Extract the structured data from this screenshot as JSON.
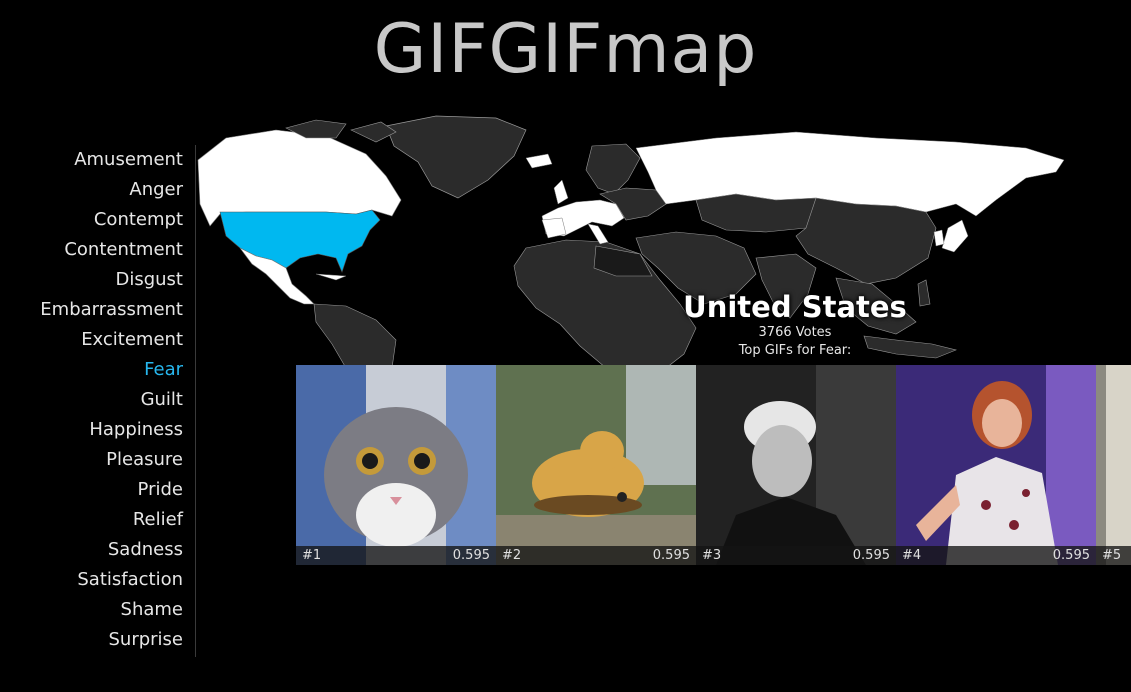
{
  "app": {
    "title": "GIFGIFmap"
  },
  "emotions": [
    {
      "label": "Amusement",
      "active": false
    },
    {
      "label": "Anger",
      "active": false
    },
    {
      "label": "Contempt",
      "active": false
    },
    {
      "label": "Contentment",
      "active": false
    },
    {
      "label": "Disgust",
      "active": false
    },
    {
      "label": "Embarrassment",
      "active": false
    },
    {
      "label": "Excitement",
      "active": false
    },
    {
      "label": "Fear",
      "active": true
    },
    {
      "label": "Guilt",
      "active": false
    },
    {
      "label": "Happiness",
      "active": false
    },
    {
      "label": "Pleasure",
      "active": false
    },
    {
      "label": "Pride",
      "active": false
    },
    {
      "label": "Relief",
      "active": false
    },
    {
      "label": "Sadness",
      "active": false
    },
    {
      "label": "Satisfaction",
      "active": false
    },
    {
      "label": "Shame",
      "active": false
    },
    {
      "label": "Surprise",
      "active": false
    }
  ],
  "country": {
    "name": "United States",
    "votes": "3766 Votes",
    "top_label": "Top GIFs for Fear:"
  },
  "gifs": [
    {
      "rank": "#1",
      "score": "0.595"
    },
    {
      "rank": "#2",
      "score": "0.595"
    },
    {
      "rank": "#3",
      "score": "0.595"
    },
    {
      "rank": "#4",
      "score": "0.595"
    },
    {
      "rank": "#5",
      "score": ""
    }
  ],
  "colors": {
    "active_emotion": "#27b7ee",
    "selected_country": "#00b8f0",
    "map_light": "#ffffff",
    "map_dark": "#2b2b2b"
  }
}
